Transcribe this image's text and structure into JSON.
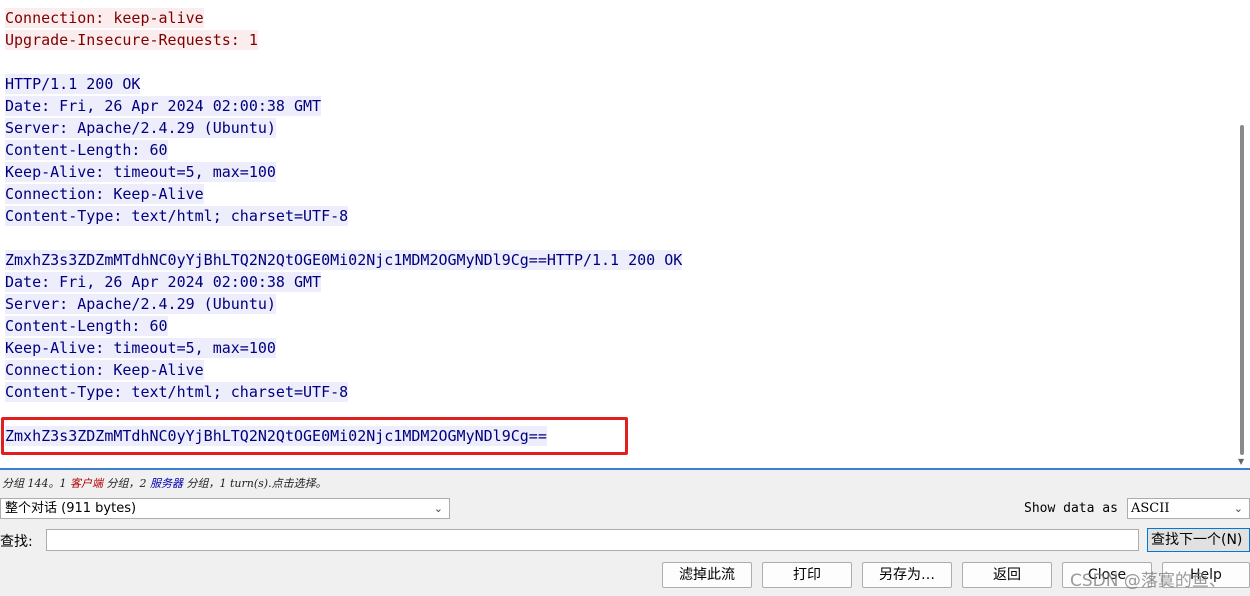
{
  "stream": {
    "lines": [
      {
        "role": "client",
        "text": "Connection: keep-alive"
      },
      {
        "role": "client",
        "text": "Upgrade-Insecure-Requests: 1"
      },
      {
        "role": "blank",
        "text": ""
      },
      {
        "role": "server",
        "text": "HTTP/1.1 200 OK"
      },
      {
        "role": "server",
        "text": "Date: Fri, 26 Apr 2024 02:00:38 GMT"
      },
      {
        "role": "server",
        "text": "Server: Apache/2.4.29 (Ubuntu)"
      },
      {
        "role": "server",
        "text": "Content-Length: 60"
      },
      {
        "role": "server",
        "text": "Keep-Alive: timeout=5, max=100"
      },
      {
        "role": "server",
        "text": "Connection: Keep-Alive"
      },
      {
        "role": "server",
        "text": "Content-Type: text/html; charset=UTF-8"
      },
      {
        "role": "blank",
        "text": ""
      },
      {
        "role": "server",
        "text": "ZmxhZ3s3ZDZmMTdhNC0yYjBhLTQ2N2QtOGE0Mi02Njc1MDM2OGMyNDl9Cg==HTTP/1.1 200 OK"
      },
      {
        "role": "server",
        "text": "Date: Fri, 26 Apr 2024 02:00:38 GMT"
      },
      {
        "role": "server",
        "text": "Server: Apache/2.4.29 (Ubuntu)"
      },
      {
        "role": "server",
        "text": "Content-Length: 60"
      },
      {
        "role": "server",
        "text": "Keep-Alive: timeout=5, max=100"
      },
      {
        "role": "server",
        "text": "Connection: Keep-Alive"
      },
      {
        "role": "server",
        "text": "Content-Type: text/html; charset=UTF-8"
      },
      {
        "role": "blank",
        "text": ""
      },
      {
        "role": "server",
        "text": "ZmxhZ3s3ZDZmMTdhNC0yYjBhLTQ2N2QtOGE0Mi02Njc1MDM2OGMyNDl9Cg=="
      }
    ]
  },
  "status": {
    "prefix": "分组 144。1 ",
    "client_word": "客户端",
    "middle": " 分组，2 ",
    "server_word": "服务器",
    "suffix": " 分组，1 turn(s).点击选择。"
  },
  "controls": {
    "conversation_select": "整个对话 (911 bytes)",
    "show_data_label": "Show data as",
    "show_data_value": "ASCII",
    "find_label": "查找:",
    "find_value": "",
    "find_next": "查找下一个(N)"
  },
  "buttons": {
    "filter": "滤掉此流",
    "print": "打印",
    "save_as": "另存为…",
    "back": "返回",
    "close": "Close",
    "help": "Help"
  },
  "watermark": "CSDN @落寞的鱼、",
  "colors": {
    "client_fg": "#7f0000",
    "client_bg": "#fbeded",
    "server_fg": "#00007f",
    "server_bg": "#ededfb",
    "highlight": "#e21f1f"
  }
}
